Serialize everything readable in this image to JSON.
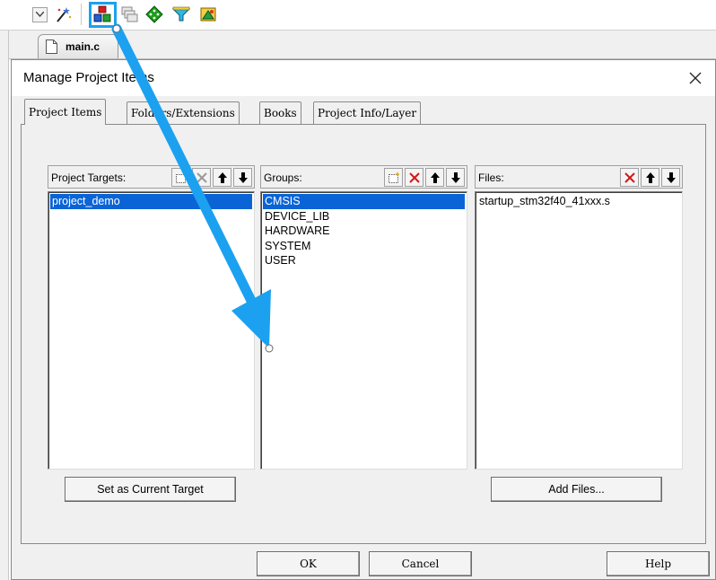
{
  "toolbar": {
    "icons": [
      "dropdown-arrow-icon",
      "magic-wand-icon",
      "project-items-icon",
      "window-stack-icon",
      "green-diamond-icon",
      "download-funnel-icon",
      "books-icon"
    ]
  },
  "editor": {
    "tab_label": "main.c"
  },
  "dialog": {
    "title": "Manage Project Items",
    "tabs": [
      {
        "label": "Project Items",
        "active": true
      },
      {
        "label": "Folders/Extensions",
        "active": false
      },
      {
        "label": "Books",
        "active": false
      },
      {
        "label": "Project Info/Layer",
        "active": false
      }
    ],
    "targets": {
      "label": "Project Targets:",
      "items": [
        {
          "text": "project_demo",
          "selected": true
        }
      ]
    },
    "groups": {
      "label": "Groups:",
      "items": [
        {
          "text": "CMSIS",
          "selected": true
        },
        {
          "text": "DEVICE_LIB",
          "selected": false
        },
        {
          "text": "HARDWARE",
          "selected": false
        },
        {
          "text": "SYSTEM",
          "selected": false
        },
        {
          "text": "USER",
          "selected": false
        }
      ]
    },
    "files": {
      "label": "Files:",
      "items": [
        {
          "text": "startup_stm32f40_41xxx.s",
          "selected": false
        }
      ]
    },
    "buttons": {
      "set_current_target": "Set as Current Target",
      "add_files": "Add Files...",
      "ok": "OK",
      "cancel": "Cancel",
      "help": "Help"
    }
  },
  "colors": {
    "selection": "#0a64d6",
    "annotation": "#1ba1f0",
    "delete_red": "#d01818"
  }
}
